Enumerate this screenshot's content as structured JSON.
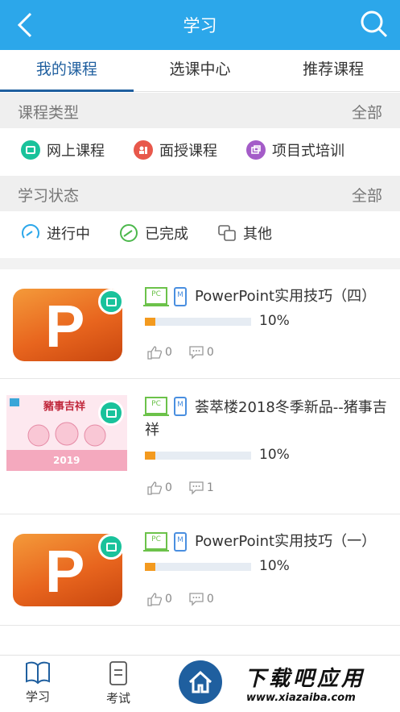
{
  "header": {
    "title": "学习"
  },
  "tabs": [
    {
      "label": "我的课程"
    },
    {
      "label": "选课中心"
    },
    {
      "label": "推荐课程"
    }
  ],
  "course_type": {
    "label": "课程类型",
    "all_label": "全部",
    "options": [
      {
        "label": "网上课程",
        "icon": "online-course-icon",
        "color": "#19c29b"
      },
      {
        "label": "面授课程",
        "icon": "face-to-face-icon",
        "color": "#e8584b"
      },
      {
        "label": "项目式培训",
        "icon": "project-training-icon",
        "color": "#a45cc8"
      }
    ]
  },
  "study_status": {
    "label": "学习状态",
    "all_label": "全部",
    "options": [
      {
        "label": "进行中",
        "icon": "in-progress-icon",
        "color": "#2ca7ea"
      },
      {
        "label": "已完成",
        "icon": "completed-icon",
        "color": "#4cb84c"
      },
      {
        "label": "其他",
        "icon": "other-icon",
        "color": "#666666"
      }
    ]
  },
  "courses": [
    {
      "title": "PowerPoint实用技巧（四）",
      "pc_tag": "PC",
      "mobile_tag": "M",
      "progress_pct": 10,
      "progress_label": "10%",
      "likes": "0",
      "comments": "0"
    },
    {
      "title": "荟萃楼2018冬季新品--猪事吉祥",
      "pc_tag": "PC",
      "mobile_tag": "M",
      "progress_pct": 10,
      "progress_label": "10%",
      "likes": "0",
      "comments": "1",
      "thumb_text": "豬事吉祥",
      "thumb_year": "2019"
    },
    {
      "title": "PowerPoint实用技巧（一）",
      "pc_tag": "PC",
      "mobile_tag": "M",
      "progress_pct": 10,
      "progress_label": "10%",
      "likes": "0",
      "comments": "0"
    }
  ],
  "ppt_letter": "P",
  "bottom_nav": {
    "study": "学习",
    "exam": "考试"
  },
  "watermark": {
    "big": "下载吧应用",
    "small": "www.xiazaiba.com"
  },
  "colors": {
    "brand": "#2ca7ea",
    "accent": "#1f5f9f",
    "progress": "#f39a1f"
  }
}
